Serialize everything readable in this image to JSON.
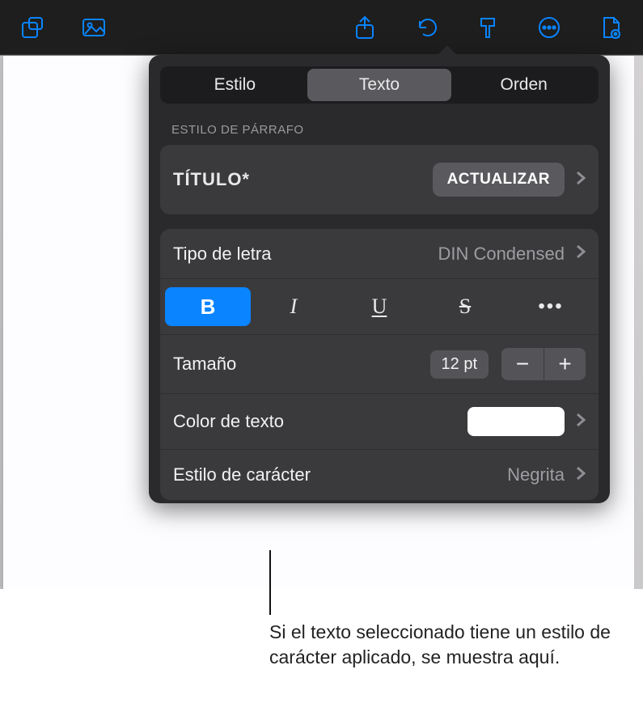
{
  "toolbar": {
    "icons": [
      "shapes",
      "media",
      "share",
      "undo",
      "format-brush",
      "more",
      "document-settings"
    ]
  },
  "popover": {
    "tabs": {
      "style": "Estilo",
      "text": "Texto",
      "order": "Orden",
      "active": "text"
    },
    "paragraph_section_label": "ESTILO DE PÁRRAFO",
    "paragraph_style_name": "TÍTULO*",
    "update_button": "ACTUALIZAR",
    "font": {
      "label": "Tipo de letra",
      "value": "DIN Condensed"
    },
    "bius": {
      "bold_active": true
    },
    "size": {
      "label": "Tamaño",
      "value": "12 pt"
    },
    "text_color": {
      "label": "Color de texto",
      "swatch": "#ffffff"
    },
    "character_style": {
      "label": "Estilo de carácter",
      "value": "Negrita"
    }
  },
  "callout": "Si el texto seleccionado tiene un estilo de carácter aplicado, se muestra aquí."
}
